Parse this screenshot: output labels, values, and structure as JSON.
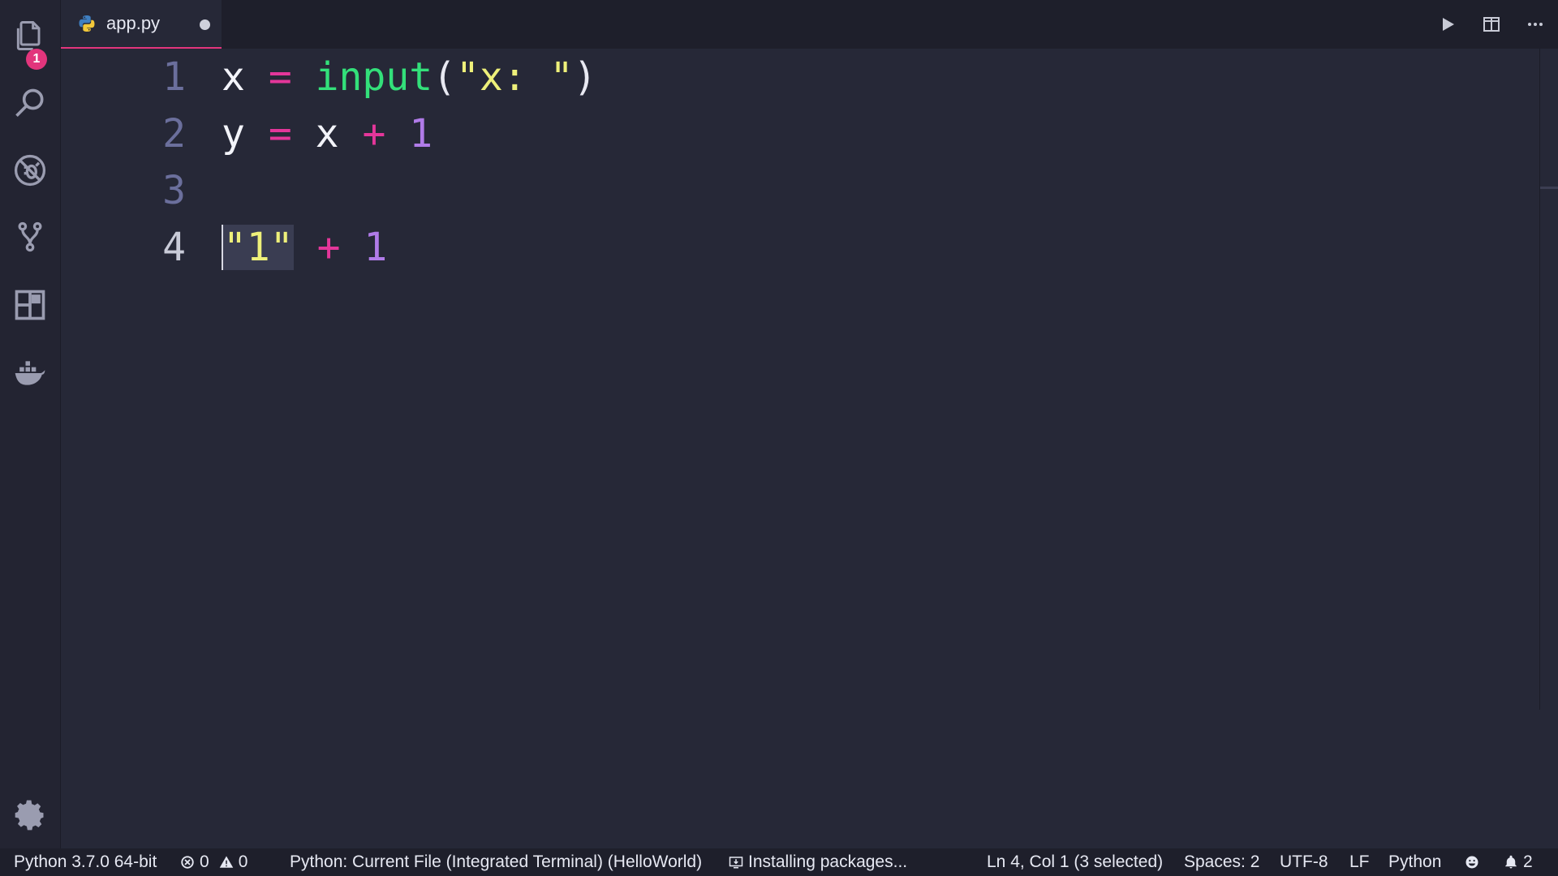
{
  "activity_bar": {
    "items": [
      {
        "name": "explorer-icon",
        "badge": "1"
      },
      {
        "name": "search-icon"
      },
      {
        "name": "debug-icon"
      },
      {
        "name": "source-control-icon"
      },
      {
        "name": "extensions-icon"
      },
      {
        "name": "docker-icon"
      }
    ],
    "settings_icon": "gear-icon"
  },
  "tab": {
    "label": "app.py",
    "icon": "python-icon",
    "dirty": true
  },
  "editor": {
    "lines": [
      {
        "number": "1",
        "text": "x = input(\"x: \")"
      },
      {
        "number": "2",
        "text": "y = x + 1"
      },
      {
        "number": "3",
        "text": ""
      },
      {
        "number": "4",
        "text": "\"1\" + 1",
        "selection": "\"1\""
      }
    ]
  },
  "status_bar": {
    "interpreter": "Python 3.7.0 64-bit",
    "errors": "0",
    "warnings": "0",
    "debug_config": "Python: Current File (Integrated Terminal) (HelloWorld)",
    "task": "Installing packages...",
    "cursor": "Ln 4, Col 1 (3 selected)",
    "spaces": "Spaces: 2",
    "encoding": "UTF-8",
    "eol": "LF",
    "language": "Python",
    "notifications": "2"
  },
  "colors": {
    "accent": "#e2357c",
    "keyword_op": "#e4369a",
    "function": "#33e07a",
    "string": "#eef07a",
    "number": "#b07be8",
    "background": "#262837"
  }
}
